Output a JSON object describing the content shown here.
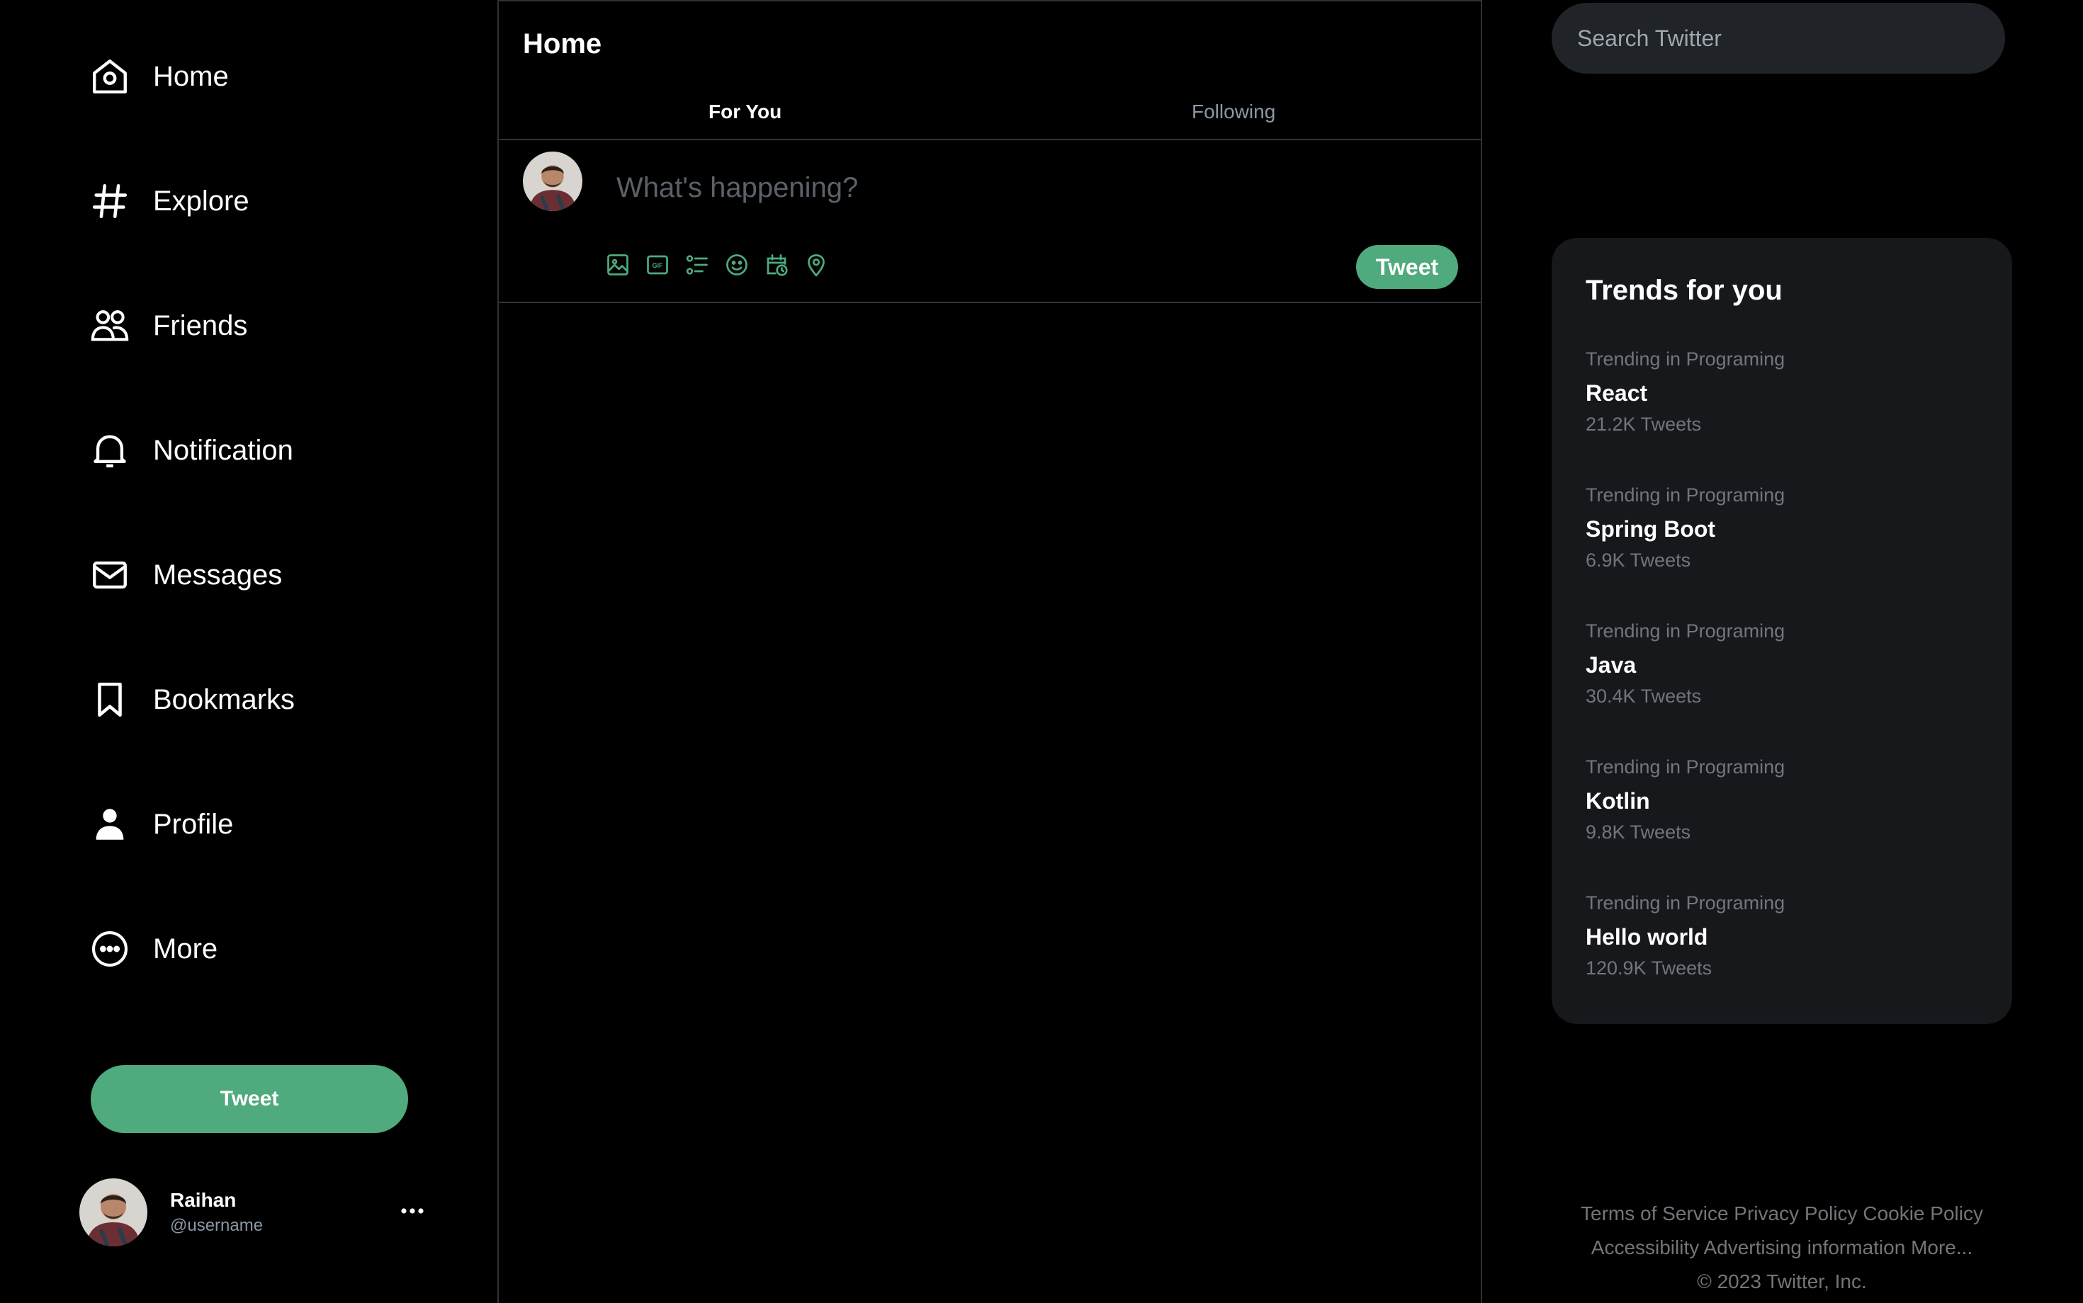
{
  "sidebar": {
    "nav": [
      {
        "label": "Home",
        "icon": "home-icon"
      },
      {
        "label": "Explore",
        "icon": "hashtag-icon"
      },
      {
        "label": "Friends",
        "icon": "friends-icon"
      },
      {
        "label": "Notification",
        "icon": "bell-icon"
      },
      {
        "label": "Messages",
        "icon": "envelope-icon"
      },
      {
        "label": "Bookmarks",
        "icon": "bookmark-icon"
      },
      {
        "label": "Profile",
        "icon": "person-icon"
      },
      {
        "label": "More",
        "icon": "more-circle-icon"
      }
    ],
    "tweet_label": "Tweet",
    "account": {
      "name": "Raihan",
      "handle": "@username"
    }
  },
  "main": {
    "title": "Home",
    "tabs": [
      {
        "label": "For You",
        "active": true
      },
      {
        "label": "Following",
        "active": false
      }
    ],
    "composer": {
      "placeholder": "What's happening?",
      "tools": [
        "image-icon",
        "gif-icon",
        "poll-icon",
        "emoji-icon",
        "schedule-icon",
        "location-icon"
      ],
      "tweet_label": "Tweet"
    }
  },
  "right": {
    "search_placeholder": "Search Twitter",
    "trends_title": "Trends for you",
    "trends": [
      {
        "category": "Trending in Programing",
        "topic": "React",
        "count": "21.2K Tweets"
      },
      {
        "category": "Trending in Programing",
        "topic": "Spring Boot",
        "count": "6.9K Tweets"
      },
      {
        "category": "Trending in Programing",
        "topic": "Java",
        "count": "30.4K Tweets"
      },
      {
        "category": "Trending in Programing",
        "topic": "Kotlin",
        "count": "9.8K Tweets"
      },
      {
        "category": "Trending in Programing",
        "topic": "Hello world",
        "count": "120.9K Tweets"
      }
    ],
    "footer": {
      "links_row1": [
        "Terms of Service",
        "Privacy Policy",
        "Cookie Policy"
      ],
      "links_row2": [
        "Accessibility",
        "Advertising",
        "information",
        "More..."
      ],
      "copyright": "© 2023 Twitter, Inc."
    }
  },
  "colors": {
    "accent": "#4faa7d",
    "background": "#000000",
    "panel": "#16181c",
    "muted_text": "#71767b"
  }
}
